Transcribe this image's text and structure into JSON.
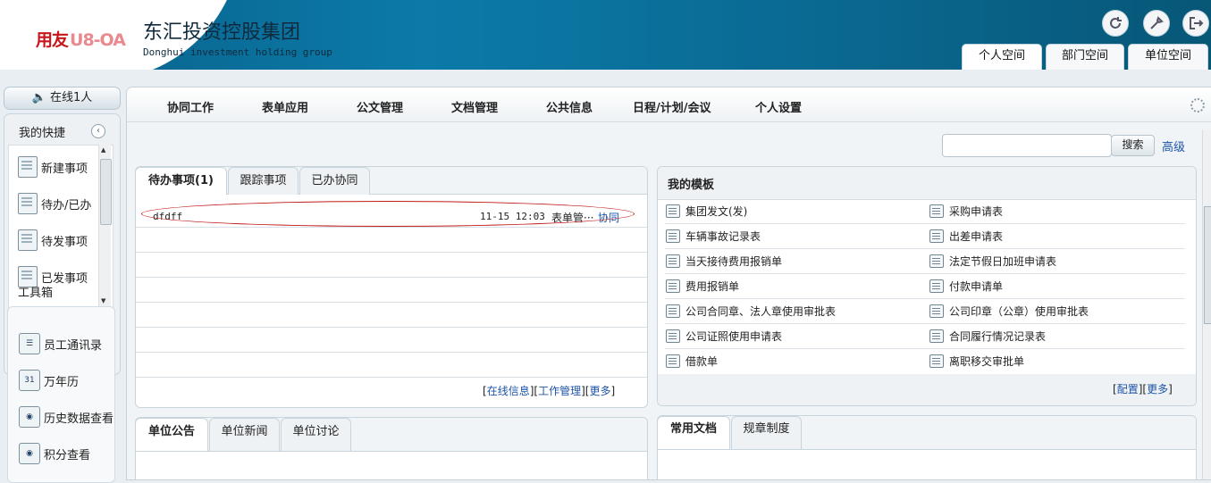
{
  "header": {
    "logo_a": "用友",
    "logo_b": "U8-OA",
    "company_cn": "东汇投资控股集团",
    "company_en": "Donghui investment holding group",
    "icons": [
      "refresh-icon",
      "tools-icon",
      "logout-icon"
    ],
    "spaces": [
      "个人空间",
      "部门空间",
      "单位空间"
    ]
  },
  "left": {
    "online": "在线1人",
    "quick_title": "我的快捷",
    "quick_items": [
      "新建事项",
      "待办/已办",
      "待发事项",
      "已发事项"
    ],
    "tools_title": "工具箱",
    "tools": [
      "员工通讯录",
      "万年历",
      "历史数据查看",
      "积分查看"
    ],
    "calendar_icon_text": "31"
  },
  "menu": [
    "协同工作",
    "表单应用",
    "公文管理",
    "文档管理",
    "公共信息",
    "日程/计划/会议",
    "个人设置"
  ],
  "search": {
    "button": "搜索",
    "advanced": "高级"
  },
  "pending": {
    "tabs": [
      "待办事项(1)",
      "跟踪事项",
      "已办协同"
    ],
    "rows": [
      {
        "title": "dfdff",
        "time": "11-15 12:03",
        "category": "表单管···",
        "type": "协同"
      }
    ],
    "footer": {
      "l1": "[",
      "a1": "在线信息",
      "l2": "][",
      "a2": "工作管理",
      "l3": "][",
      "a3": "更多",
      "l4": "]"
    }
  },
  "templates": {
    "title": "我的模板",
    "items": [
      "集团发文(发)",
      "采购申请表",
      "车辆事故记录表",
      "出差申请表",
      "当天接待费用报销单",
      "法定节假日加班申请表",
      "费用报销单",
      "付款申请单",
      "公司合同章、法人章使用审批表",
      "公司印章（公章）使用审批表",
      "公司证照使用申请表",
      "合同履行情况记录表",
      "借款单",
      "离职移交审批单"
    ],
    "footer": {
      "l1": "[",
      "a1": "配置",
      "l2": "][",
      "a2": "更多",
      "l3": "]"
    }
  },
  "announce": {
    "tabs": [
      "单位公告",
      "单位新闻",
      "单位讨论"
    ]
  },
  "docs": {
    "tabs": [
      "常用文档",
      "规章制度"
    ]
  }
}
